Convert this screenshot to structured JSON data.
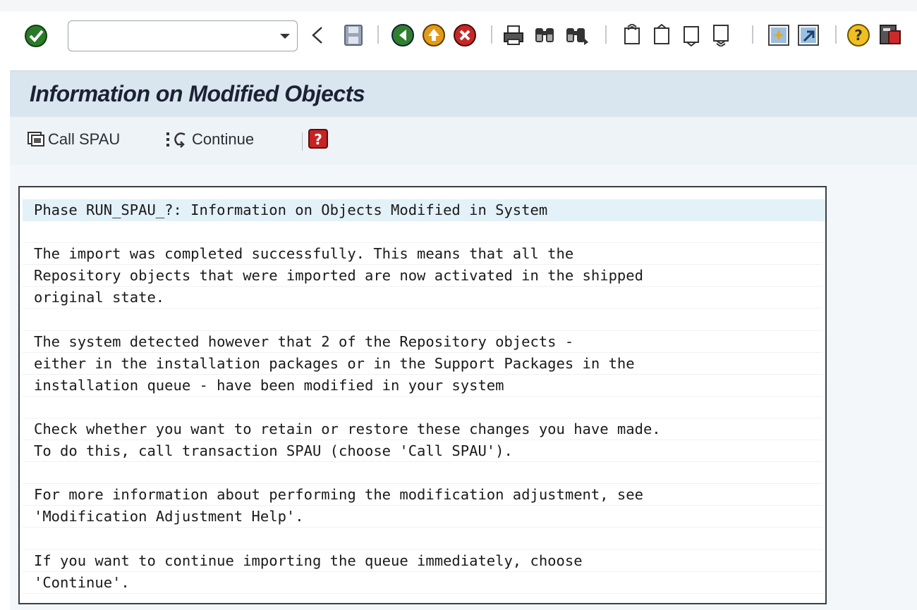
{
  "system_toolbar": {
    "command_field_value": "",
    "icons": [
      "enter-check-icon",
      "back-triangle-icon",
      "save-icon",
      "back-icon",
      "exit-icon",
      "cancel-icon",
      "print-icon",
      "find-icon",
      "find-next-icon",
      "first-page-icon",
      "previous-page-icon",
      "next-page-icon",
      "last-page-icon",
      "create-session-icon",
      "shortcut-icon",
      "help-icon",
      "layout-menu-icon"
    ]
  },
  "screen": {
    "title": "Information on Modified Objects"
  },
  "app_toolbar": {
    "call_spau_label": "Call SPAU",
    "continue_label": "Continue"
  },
  "message": {
    "lines": [
      "Phase RUN_SPAU_?: Information on Objects Modified in System",
      "",
      "The import was completed successfully. This means that all the",
      "Repository objects that were imported are now activated in the shipped",
      "original state.",
      "",
      "The system detected however that 2 of the Repository objects -",
      "either in the installation packages or in the Support Packages in the",
      "installation queue - have been modified in your system",
      "",
      "Check whether you want to retain or restore these changes you have made.",
      "To do this, call transaction SPAU (choose 'Call SPAU').",
      "",
      "For more information about performing the modification adjustment, see",
      "'Modification Adjustment Help'.",
      "",
      "If you want to continue importing the queue immediately, choose",
      "'Continue'."
    ]
  },
  "colors": {
    "title_bg": "#d9e5ef",
    "toolbar_bg": "#eef3f7",
    "highlight_row": "#e3f1f8"
  }
}
